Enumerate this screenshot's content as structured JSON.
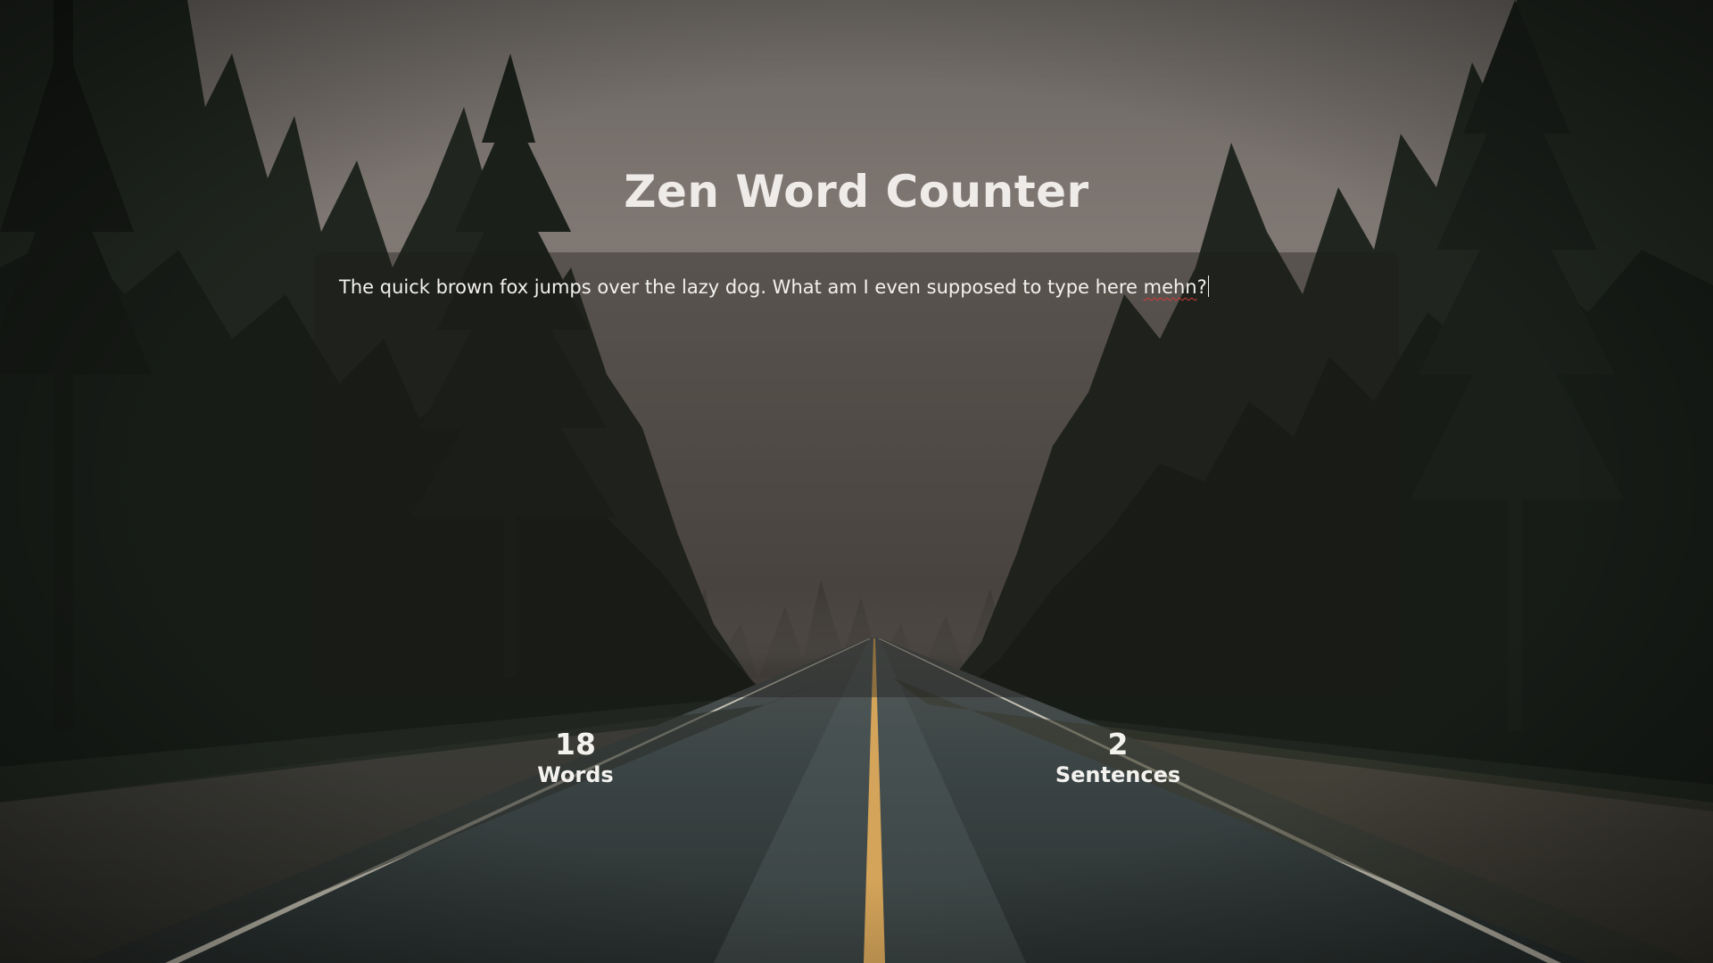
{
  "app": {
    "title": "Zen Word Counter"
  },
  "editor": {
    "text_before": "The quick brown fox jumps over the lazy dog. What am I even supposed to type here ",
    "misspelled_word": "mehn",
    "text_after": "?"
  },
  "stats": {
    "words": {
      "value": "18",
      "label": "Words"
    },
    "sentences": {
      "value": "2",
      "label": "Sentences"
    }
  },
  "colors": {
    "sky": "#7a7470",
    "forest": "#1c221d",
    "road": "#3c4547",
    "center_line": "#d4a45a",
    "edge_line": "#d8d2c2"
  }
}
